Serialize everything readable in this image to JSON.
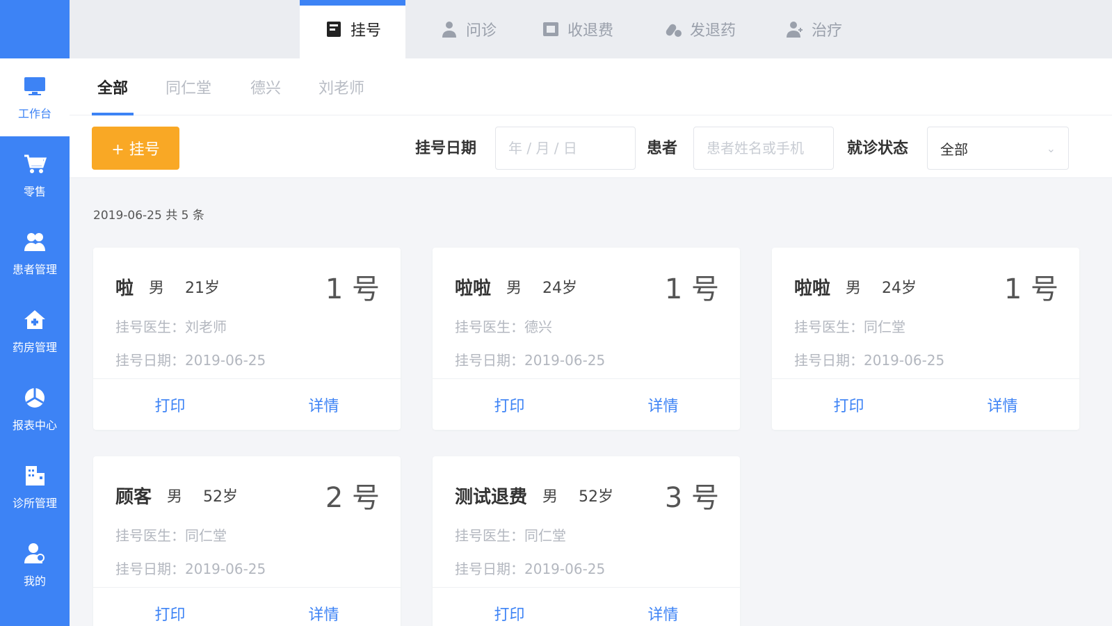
{
  "sidebar": {
    "items": [
      {
        "label": "工作台",
        "icon": "monitor-icon",
        "active": true
      },
      {
        "label": "零售",
        "icon": "cart-icon"
      },
      {
        "label": "患者管理",
        "icon": "users-icon"
      },
      {
        "label": "药房管理",
        "icon": "house-icon"
      },
      {
        "label": "报表中心",
        "icon": "chart-pie-icon"
      },
      {
        "label": "诊所管理",
        "icon": "clinic-icon"
      },
      {
        "label": "我的",
        "icon": "user-icon"
      }
    ]
  },
  "modules": {
    "tabs": [
      {
        "label": "挂号",
        "icon": "register-icon",
        "active": true
      },
      {
        "label": "问诊",
        "icon": "doctor-icon"
      },
      {
        "label": "收退费",
        "icon": "cashier-icon"
      },
      {
        "label": "发退药",
        "icon": "medicine-icon"
      },
      {
        "label": "治疗",
        "icon": "treatment-icon"
      }
    ]
  },
  "subtabs": [
    "全部",
    "同仁堂",
    "德兴",
    "刘老师"
  ],
  "filters": {
    "add_label": "+ 挂号",
    "date_label": "挂号日期",
    "date_placeholder": "年 / 月 / 日",
    "patient_label": "患者",
    "patient_placeholder": "患者姓名或手机",
    "status_label": "就诊状态",
    "status_value": "全部"
  },
  "summary": "2019-06-25 共 5 条",
  "cards": [
    {
      "name": "啦",
      "sex": "男",
      "age": "21岁",
      "number": "1 号",
      "doctor": "挂号医生：刘老师",
      "date": "挂号日期：2019-06-25",
      "print": "打印",
      "detail": "详情"
    },
    {
      "name": "啦啦",
      "sex": "男",
      "age": "24岁",
      "number": "1 号",
      "doctor": "挂号医生：德兴",
      "date": "挂号日期：2019-06-25",
      "print": "打印",
      "detail": "详情"
    },
    {
      "name": "啦啦",
      "sex": "男",
      "age": "24岁",
      "number": "1 号",
      "doctor": "挂号医生：同仁堂",
      "date": "挂号日期：2019-06-25",
      "print": "打印",
      "detail": "详情"
    },
    {
      "name": "顾客",
      "sex": "男",
      "age": "52岁",
      "number": "2 号",
      "doctor": "挂号医生：同仁堂",
      "date": "挂号日期：2019-06-25",
      "print": "打印",
      "detail": "详情"
    },
    {
      "name": "测试退费",
      "sex": "男",
      "age": "52岁",
      "number": "3 号",
      "doctor": "挂号医生：同仁堂",
      "date": "挂号日期：2019-06-25",
      "print": "打印",
      "detail": "详情"
    }
  ],
  "colors": {
    "primary": "#3d83f5",
    "accent": "#f9a825"
  }
}
